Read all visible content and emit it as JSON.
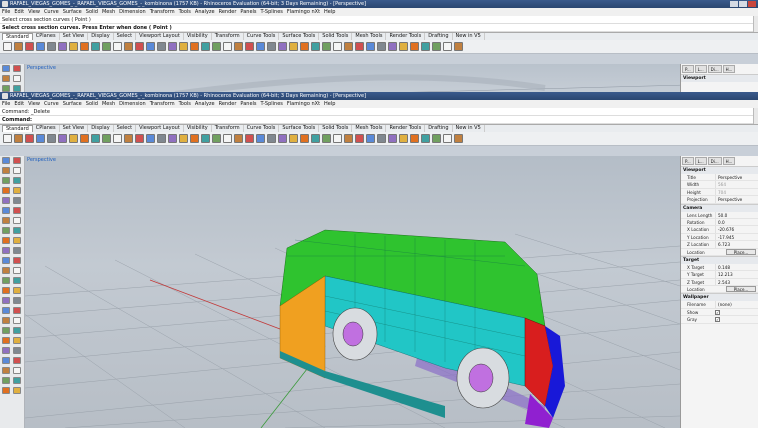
{
  "back_window": {
    "title": "RAFAEL_VIEGAS_GOMES_-_RAFAEL_VIEGAS_GOMES_-_kombinona (1757 KB) - Rhinoceros Evaluation (64-bit; 3 Days Remaining) - [Perspective]",
    "menu": [
      "File",
      "Edit",
      "View",
      "Curve",
      "Surface",
      "Solid",
      "Mesh",
      "Dimension",
      "Transform",
      "Tools",
      "Analyze",
      "Render",
      "Panels",
      "T-Splines",
      "Flamingo nXt",
      "Help"
    ],
    "command_history": "Select cross section curves ( Point )",
    "command_prompt": "Select cross section curves. Press Enter when done ( Point )",
    "tabs": [
      "Standard",
      "CPlanes",
      "Set View",
      "Display",
      "Select",
      "Viewport Layout",
      "Visibility",
      "Transform",
      "Curve Tools",
      "Surface Tools",
      "Solid Tools",
      "Mesh Tools",
      "Render Tools",
      "Drafting",
      "New in V5"
    ],
    "viewport_label": "Perspective",
    "panel_tabs": [
      "P...",
      "L...",
      "Di...",
      "H..."
    ],
    "panel_section": "Viewport"
  },
  "front_window": {
    "title": "RAFAEL_VIEGAS_GOMES_-_RAFAEL_VIEGAS_GOMES_-_kombinona (1757 KB) - Rhinoceros Evaluation (64-bit; 3 Days Remaining) - [Perspective]",
    "menu": [
      "File",
      "Edit",
      "View",
      "Curve",
      "Surface",
      "Solid",
      "Mesh",
      "Dimension",
      "Transform",
      "Tools",
      "Analyze",
      "Render",
      "Panels",
      "T-Splines",
      "Flamingo nXt",
      "Help"
    ],
    "command_history": "Command: _Delete",
    "command_prompt": "Command:",
    "tabs": [
      "Standard",
      "CPlanes",
      "Set View",
      "Display",
      "Select",
      "Viewport Layout",
      "Visibility",
      "Transform",
      "Curve Tools",
      "Surface Tools",
      "Solid Tools",
      "Mesh Tools",
      "Render Tools",
      "Drafting",
      "New in V5"
    ],
    "viewport_label": "Perspective",
    "panel_tabs": [
      "P...",
      "L...",
      "Di...",
      "H..."
    ]
  },
  "properties": {
    "viewport_section": "Viewport",
    "title_label": "Title",
    "title_value": "Perspective",
    "width_label": "Width",
    "width_value": "564",
    "height_label": "Height",
    "height_value": "704",
    "projection_label": "Projection",
    "projection_value": "Perspective",
    "camera_section": "Camera",
    "lens_label": "Lens Length",
    "lens_value": "50.0",
    "rotation_label": "Rotation",
    "rotation_value": "0.0",
    "xloc_label": "X Location",
    "xloc_value": "-20.676",
    "yloc_label": "Y Location",
    "yloc_value": "-17.945",
    "zloc_label": "Z Location",
    "zloc_value": "6.723",
    "location_label": "Location",
    "place_button": "Place...",
    "target_section": "Target",
    "xt_label": "X Target",
    "xt_value": "0.148",
    "yt_label": "Y Target",
    "yt_value": "12.213",
    "zt_label": "Z Target",
    "zt_value": "2.543",
    "tloc_label": "Location",
    "tplace_button": "Place...",
    "wallpaper_section": "Wallpaper",
    "filename_label": "Filename",
    "filename_value": "(none)",
    "show_label": "Show",
    "gray_label": "Gray",
    "check": "✓"
  },
  "colors": {
    "bus_green": "#2fc32f",
    "bus_cyan": "#21c6c6",
    "bus_orange": "#f0a020",
    "bus_red": "#d81e1e",
    "bus_blue": "#1818d8",
    "bus_purple": "#9020d0"
  }
}
